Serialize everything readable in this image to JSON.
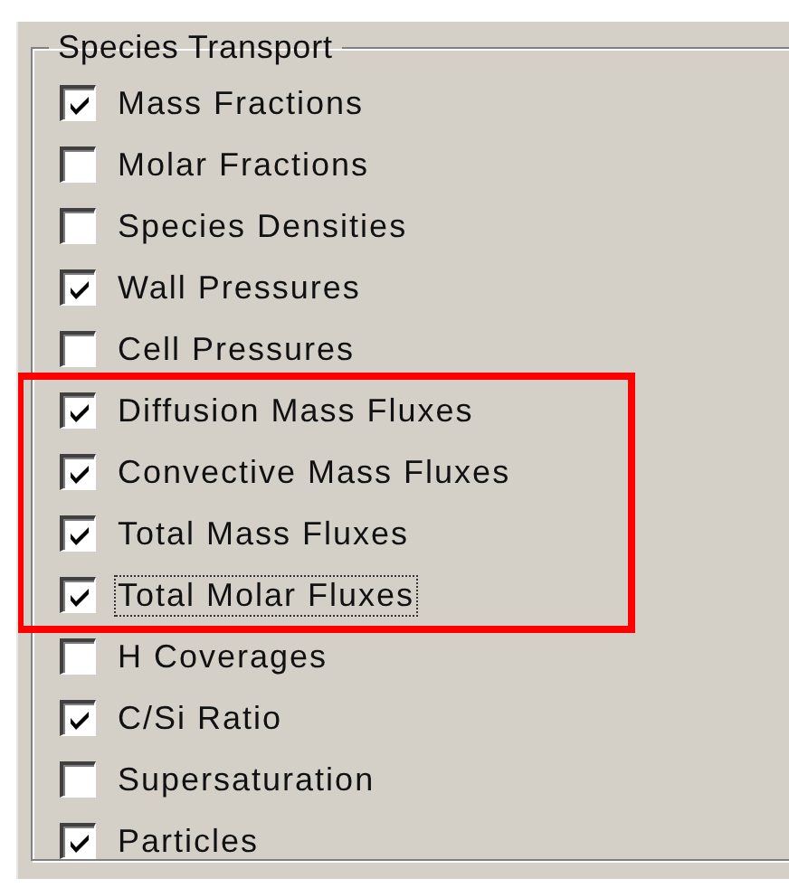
{
  "group": {
    "title": "Species Transport"
  },
  "items": [
    {
      "label": "Mass Fractions",
      "checked": true,
      "focused": false,
      "highlighted": false
    },
    {
      "label": "Molar Fractions",
      "checked": false,
      "focused": false,
      "highlighted": false
    },
    {
      "label": "Species Densities",
      "checked": false,
      "focused": false,
      "highlighted": false
    },
    {
      "label": "Wall Pressures",
      "checked": true,
      "focused": false,
      "highlighted": false
    },
    {
      "label": "Cell Pressures",
      "checked": false,
      "focused": false,
      "highlighted": false
    },
    {
      "label": "Diffusion Mass Fluxes",
      "checked": true,
      "focused": false,
      "highlighted": true
    },
    {
      "label": "Convective Mass Fluxes",
      "checked": true,
      "focused": false,
      "highlighted": true
    },
    {
      "label": "Total Mass Fluxes",
      "checked": true,
      "focused": false,
      "highlighted": true
    },
    {
      "label": "Total Molar Fluxes",
      "checked": true,
      "focused": true,
      "highlighted": true
    },
    {
      "label": "H Coverages",
      "checked": false,
      "focused": false,
      "highlighted": false
    },
    {
      "label": "C/Si Ratio",
      "checked": true,
      "focused": false,
      "highlighted": false
    },
    {
      "label": "Supersaturation",
      "checked": false,
      "focused": false,
      "highlighted": false
    },
    {
      "label": "Particles",
      "checked": true,
      "focused": false,
      "highlighted": false
    }
  ]
}
